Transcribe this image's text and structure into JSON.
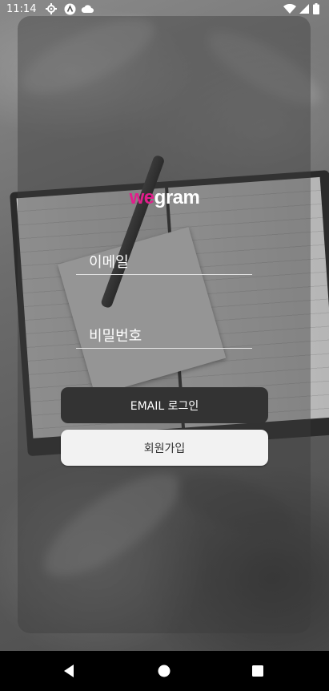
{
  "status_bar": {
    "time": "11:14",
    "icons": [
      "settings-icon",
      "app-icon",
      "cloud-icon",
      "wifi-icon",
      "signal-icon",
      "battery-icon"
    ]
  },
  "app": {
    "logo_part1": "we",
    "logo_part2": "gram",
    "brand_color": "#e21e8c"
  },
  "form": {
    "email_placeholder": "이메일",
    "password_placeholder": "비밀번호",
    "login_label": "EMAIL 로그인",
    "signup_label": "회원가입"
  },
  "navigation": {
    "buttons": [
      "back-icon",
      "home-icon",
      "recents-icon"
    ]
  }
}
